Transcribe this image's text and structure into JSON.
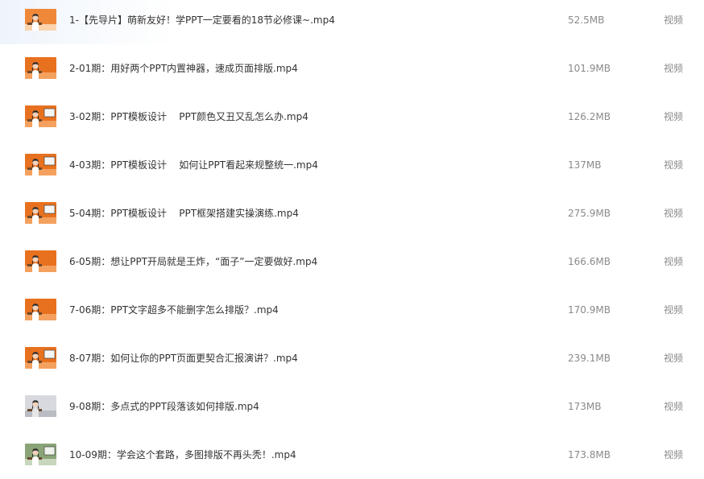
{
  "files": [
    {
      "name": "1-【先导片】萌新友好！学PPT一定要看的18节必修课~.mp4",
      "size": "52.5MB",
      "type": "视频",
      "thumb_style": "orange-light"
    },
    {
      "name": "2-01期：用好两个PPT内置神器，速成页面排版.mp4",
      "size": "101.9MB",
      "type": "视频",
      "thumb_style": "orange"
    },
    {
      "name": "3-02期：PPT模板设计    PPT颜色又丑又乱怎么办.mp4",
      "size": "126.2MB",
      "type": "视频",
      "thumb_style": "orange-screen"
    },
    {
      "name": "4-03期：PPT模板设计    如何让PPT看起来规整统一.mp4",
      "size": "137MB",
      "type": "视频",
      "thumb_style": "orange-screen"
    },
    {
      "name": "5-04期：PPT模板设计    PPT框架搭建实操演练.mp4",
      "size": "275.9MB",
      "type": "视频",
      "thumb_style": "orange-screen"
    },
    {
      "name": "6-05期：想让PPT开局就是王炸，“面子”一定要做好.mp4",
      "size": "166.6MB",
      "type": "视频",
      "thumb_style": "orange"
    },
    {
      "name": "7-06期：PPT文字超多不能删字怎么排版？.mp4",
      "size": "170.9MB",
      "type": "视频",
      "thumb_style": "orange"
    },
    {
      "name": "8-07期：如何让你的PPT页面更契合汇报演讲？.mp4",
      "size": "239.1MB",
      "type": "视频",
      "thumb_style": "orange-screen"
    },
    {
      "name": "9-08期：多点式的PPT段落该如何排版.mp4",
      "size": "173MB",
      "type": "视频",
      "thumb_style": "grey"
    },
    {
      "name": "10-09期：学会这个套路，多图排版不再头秃！.mp4",
      "size": "173.8MB",
      "type": "视频",
      "thumb_style": "green"
    }
  ],
  "colors": {
    "filename_text": "#333333",
    "meta_text": "#8a8a8a",
    "thumb_orange": "#e8711f",
    "thumb_grey": "#c9ccd2",
    "thumb_green": "#7f9a6b"
  }
}
